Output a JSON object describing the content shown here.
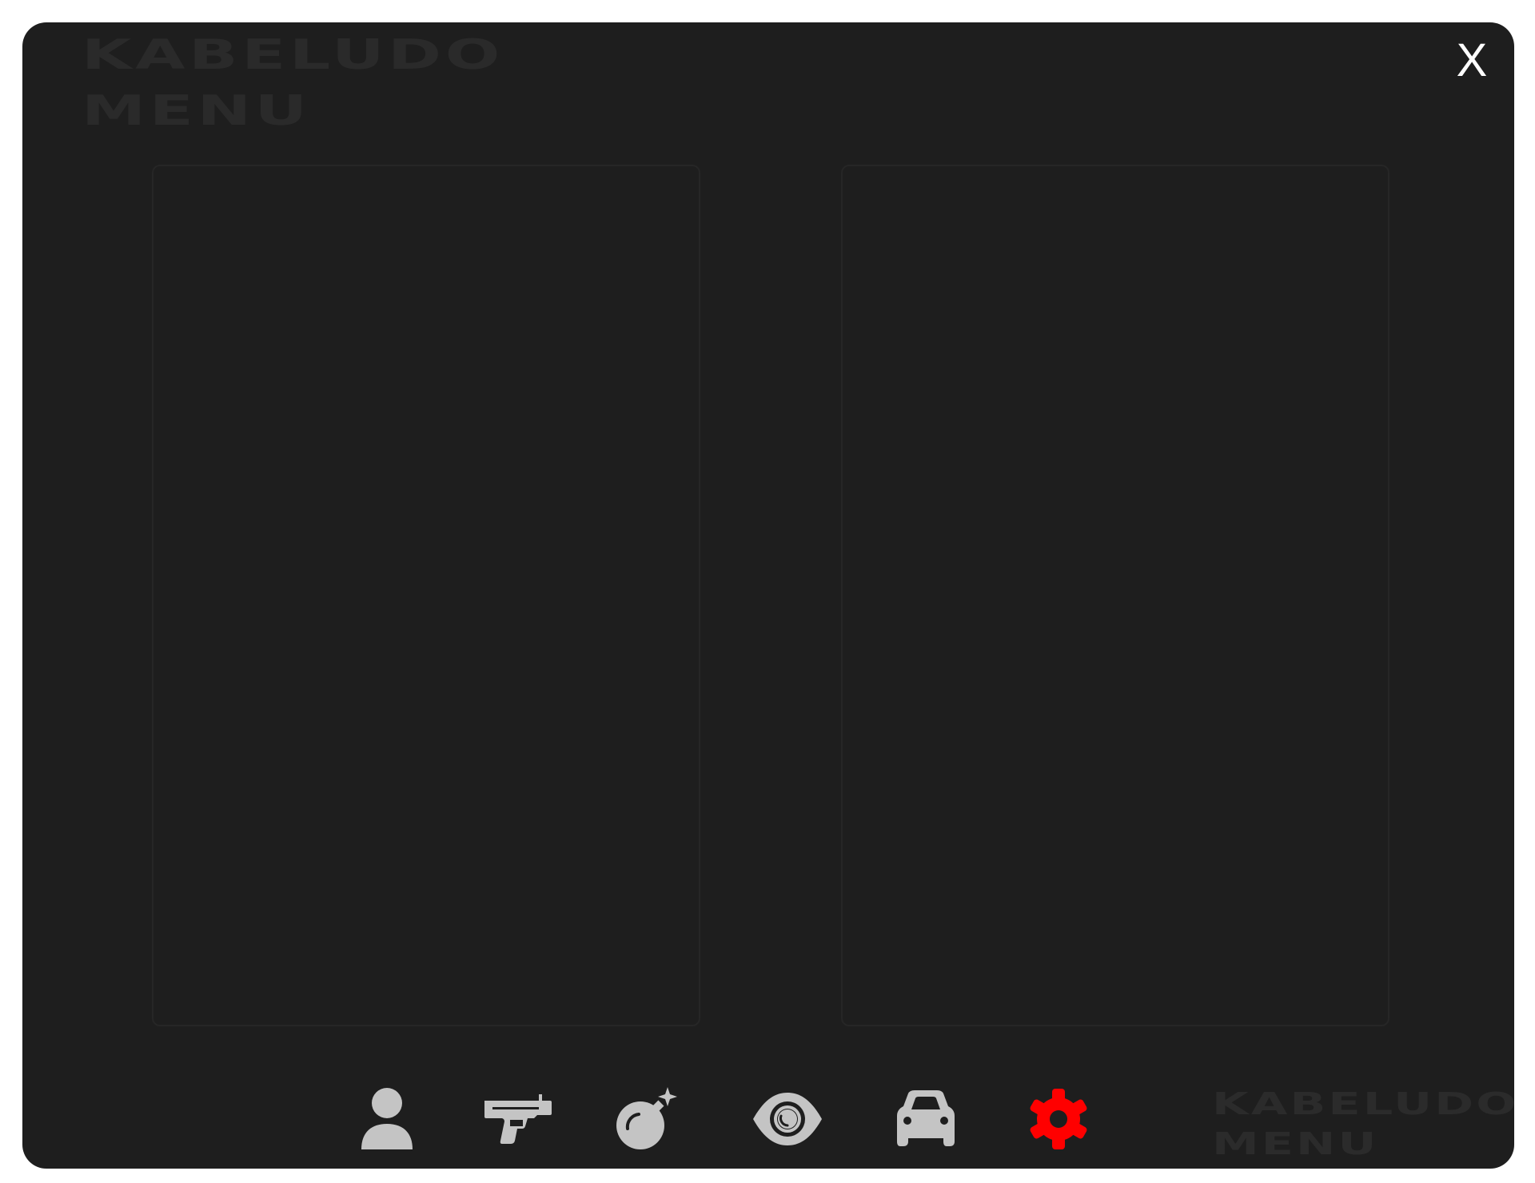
{
  "app": {
    "brand_line1": "KABELUDO",
    "brand_line2": "MENU",
    "close_label": "X"
  },
  "nav": {
    "items": [
      {
        "icon": "user-icon",
        "active": false
      },
      {
        "icon": "pistol-icon",
        "active": false
      },
      {
        "icon": "bomb-icon",
        "active": false
      },
      {
        "icon": "eye-icon",
        "active": false
      },
      {
        "icon": "car-icon",
        "active": false
      },
      {
        "icon": "gear-icon",
        "active": true
      }
    ],
    "icon_color": "#c4c4c4",
    "active_color": "#ff0000"
  },
  "colors": {
    "background": "#1e1e1e",
    "panel_border": "#262626",
    "logo_text": "#2a2a2a"
  }
}
